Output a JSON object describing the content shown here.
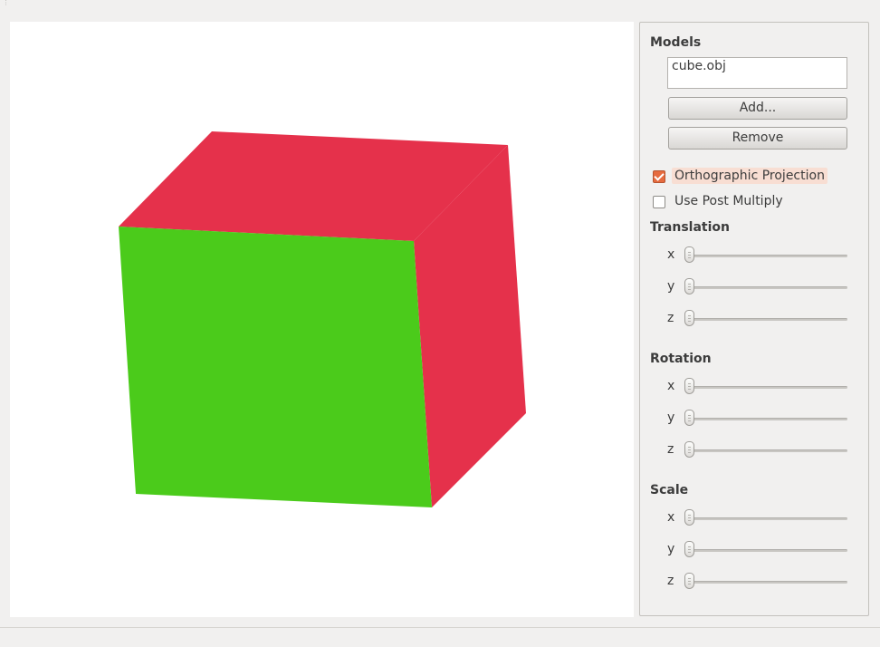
{
  "models": {
    "title": "Models",
    "items": [
      "cube.obj"
    ],
    "add_label": "Add...",
    "remove_label": "Remove"
  },
  "options": {
    "orthographic": {
      "label": "Orthographic Projection",
      "checked": true
    },
    "post_multiply": {
      "label": "Use Post Multiply",
      "checked": false
    }
  },
  "translation": {
    "title": "Translation",
    "axes": [
      {
        "label": "x",
        "value": 0
      },
      {
        "label": "y",
        "value": 0
      },
      {
        "label": "z",
        "value": 0
      }
    ]
  },
  "rotation": {
    "title": "Rotation",
    "axes": [
      {
        "label": "x",
        "value": 0
      },
      {
        "label": "y",
        "value": 0
      },
      {
        "label": "z",
        "value": 0
      }
    ]
  },
  "scale": {
    "title": "Scale",
    "axes": [
      {
        "label": "x",
        "value": 0
      },
      {
        "label": "y",
        "value": 0
      },
      {
        "label": "z",
        "value": 0
      }
    ]
  },
  "cube_colors": {
    "front_face": "#4bcb1b",
    "top_face": "#e5314b",
    "side_face": "#e5314b"
  },
  "accent_color": "#e66b3f"
}
